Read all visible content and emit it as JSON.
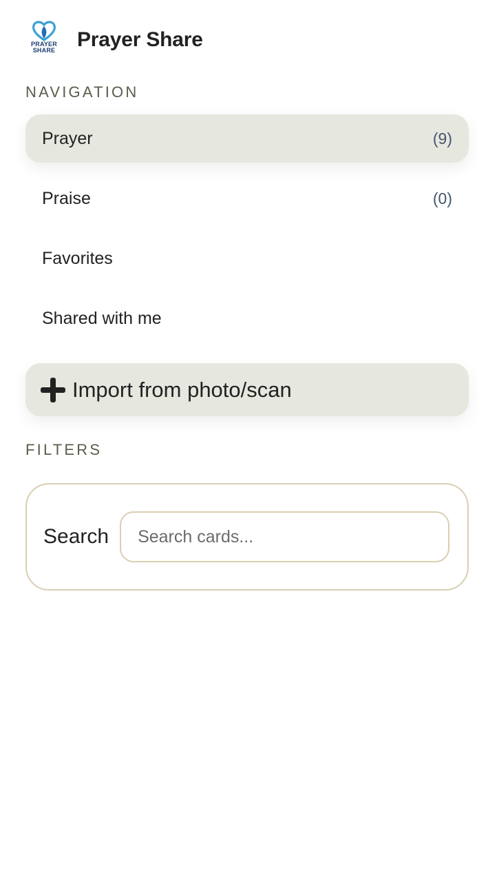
{
  "header": {
    "logo_line1": "PRAYER",
    "logo_line2": "SHARE",
    "title": "Prayer Share"
  },
  "navigation": {
    "section_label": "NAVIGATION",
    "items": [
      {
        "label": "Prayer",
        "count": "(9)",
        "active": true
      },
      {
        "label": "Praise",
        "count": "(0)",
        "active": false
      },
      {
        "label": "Favorites",
        "count": "",
        "active": false
      },
      {
        "label": "Shared with me",
        "count": "",
        "active": false
      }
    ]
  },
  "import": {
    "label": "Import from photo/scan",
    "icon": "plus-icon"
  },
  "filters": {
    "section_label": "FILTERS",
    "search_label": "Search",
    "search_placeholder": "Search cards...",
    "search_value": ""
  },
  "colors": {
    "accent_bg": "#e6e7df",
    "border_tan": "#d9ceb1",
    "logo_blue": "#1d3c6e",
    "logo_light_blue": "#3aa0d8"
  }
}
